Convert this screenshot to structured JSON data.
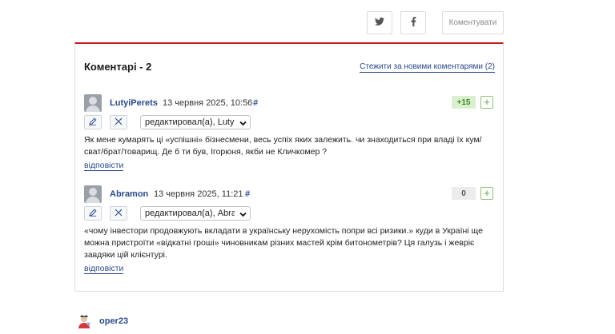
{
  "share": {
    "twitter_icon": "twitter-icon",
    "facebook_icon": "facebook-icon",
    "comment_button": "Коментувати"
  },
  "comments": {
    "title": "Коментарі - 2",
    "follow_link": "Стежити за новими коментарями (2)",
    "items": [
      {
        "author": "LutyiPerets",
        "date": "13 червня 2025, 10:56",
        "hash": "#",
        "score": "+15",
        "plus": "+",
        "edited_select": "редактировал(а), LutyiP",
        "text": "Як мене кумарять ці «успішні» бізнесмени, весь успіх яких залежить. чи знаходиться при владі їх кум/сват/брат/товарищ. Де б ти був, Ігорюня, якби не Кличкомер ?",
        "reply": "відповісти"
      },
      {
        "author": "Abramon",
        "date": "13 червня 2025, 11:21",
        "hash": "#",
        "score": "0",
        "plus": "+",
        "edited_select": "редактировал(а), Abran",
        "text": "«чому інвестори продовжують вкладати в українську нерухомість попри всі ризики.» куди в Україні ще можна пристроїти «відкатні гроші» чиновникам різних мастей крім битонометрів? Ця галузь і жевріє завдяки цій клієнтурі.",
        "reply": "відповісти"
      }
    ]
  },
  "next_user": {
    "name": "oper23"
  },
  "colors": {
    "accent_red": "#c0161d",
    "link_blue": "#2a4b8d",
    "positive_green": "#3d8a2a"
  }
}
